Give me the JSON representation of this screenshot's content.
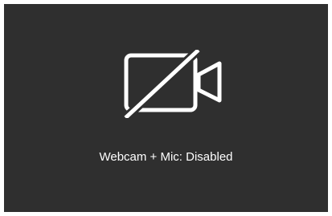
{
  "status_text": "Webcam + Mic: Disabled",
  "icon": "video-camera-off-icon",
  "colors": {
    "background": "#2f2f2f",
    "foreground": "#ffffff",
    "page": "#ffffff"
  }
}
